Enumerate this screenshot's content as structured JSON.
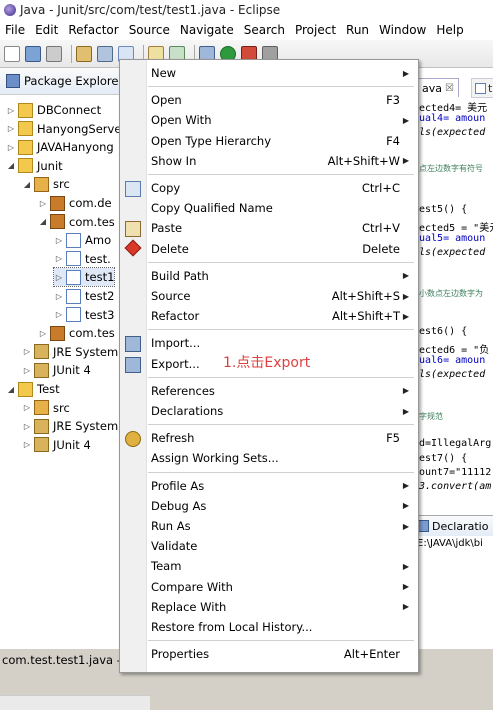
{
  "window": {
    "title": "Java - Junit/src/com/test/test1.java - Eclipse"
  },
  "menubar": [
    "File",
    "Edit",
    "Refactor",
    "Source",
    "Navigate",
    "Search",
    "Project",
    "Run",
    "Window",
    "Help"
  ],
  "package_explorer": {
    "title": "Package Explorer",
    "tree": [
      {
        "label": "DBConnect",
        "indent": 0,
        "arrow": "▷",
        "icon": "project-icon"
      },
      {
        "label": "HanyongServe",
        "indent": 0,
        "arrow": "▷",
        "icon": "project-icon"
      },
      {
        "label": "JAVAHanyong",
        "indent": 0,
        "arrow": "▷",
        "icon": "project-icon"
      },
      {
        "label": "Junit",
        "indent": 0,
        "arrow": "◢",
        "icon": "project-icon"
      },
      {
        "label": "src",
        "indent": 1,
        "arrow": "◢",
        "icon": "src-folder-icon"
      },
      {
        "label": "com.de",
        "indent": 2,
        "arrow": "▷",
        "icon": "package-icon"
      },
      {
        "label": "com.tes",
        "indent": 2,
        "arrow": "◢",
        "icon": "package-icon"
      },
      {
        "label": "Amo",
        "indent": 3,
        "arrow": "▷",
        "icon": "java-file-icon"
      },
      {
        "label": "test.",
        "indent": 3,
        "arrow": "▷",
        "icon": "java-file-icon"
      },
      {
        "label": "test1",
        "indent": 3,
        "arrow": "▷",
        "icon": "java-file-icon"
      },
      {
        "label": "test2",
        "indent": 3,
        "arrow": "▷",
        "icon": "java-file-icon"
      },
      {
        "label": "test3",
        "indent": 3,
        "arrow": "▷",
        "icon": "java-file-icon"
      },
      {
        "label": "com.tes",
        "indent": 2,
        "arrow": "▷",
        "icon": "package-icon"
      },
      {
        "label": "JRE System",
        "indent": 1,
        "arrow": "▷",
        "icon": "library-icon"
      },
      {
        "label": "JUnit 4",
        "indent": 1,
        "arrow": "▷",
        "icon": "library-icon"
      },
      {
        "label": "Test",
        "indent": 0,
        "arrow": "◢",
        "icon": "project-icon"
      },
      {
        "label": "src",
        "indent": 1,
        "arrow": "▷",
        "icon": "src-folder-icon"
      },
      {
        "label": "JRE System",
        "indent": 1,
        "arrow": "▷",
        "icon": "library-icon"
      },
      {
        "label": "JUnit 4",
        "indent": 1,
        "arrow": "▷",
        "icon": "library-icon"
      }
    ]
  },
  "editor": {
    "tab_label": "ava",
    "tab_close": "☒",
    "tab2_label": "te",
    "code_lines": [
      {
        "text": "ected4= 美元",
        "cls": ""
      },
      {
        "text": "ual4= amoun",
        "cls": "fld"
      },
      {
        "text": "ls(expected",
        "cls": "it"
      },
      {
        "text": "点左边数字有符号",
        "cls": "cm"
      },
      {
        "text": "est5() {",
        "cls": ""
      },
      {
        "text": "ected5 = \"美元",
        "cls": ""
      },
      {
        "text": "ual5= amoun",
        "cls": "fld"
      },
      {
        "text": "ls(expected",
        "cls": "it"
      },
      {
        "text": "小数点左边数字为",
        "cls": "cm"
      },
      {
        "text": "est6() {",
        "cls": ""
      },
      {
        "text": "ected6 = \"负",
        "cls": ""
      },
      {
        "text": "ual6= amoun",
        "cls": "fld"
      },
      {
        "text": "ls(expected",
        "cls": "it"
      },
      {
        "text": "字规范",
        "cls": "cm"
      },
      {
        "text": "d=IllegalArg",
        "cls": ""
      },
      {
        "text": "est7() {",
        "cls": ""
      },
      {
        "text": "ount7=\"11112",
        "cls": ""
      },
      {
        "text": "3.convert(am",
        "cls": "it"
      }
    ],
    "console_tab": "Declaratio",
    "console_path": "E:\\JAVA\\jdk\\bi"
  },
  "status": {
    "text": "com.test.test1.java - Ju"
  },
  "context_menu": {
    "items": [
      {
        "label": "New",
        "shortcut": "",
        "submenu": true,
        "icon": ""
      },
      {
        "sep": true
      },
      {
        "label": "Open",
        "shortcut": "F3",
        "submenu": false,
        "icon": ""
      },
      {
        "label": "Open With",
        "shortcut": "",
        "submenu": true,
        "icon": ""
      },
      {
        "label": "Open Type Hierarchy",
        "shortcut": "F4",
        "submenu": false,
        "icon": ""
      },
      {
        "label": "Show In",
        "shortcut": "Alt+Shift+W",
        "submenu": true,
        "icon": ""
      },
      {
        "sep": true
      },
      {
        "label": "Copy",
        "shortcut": "Ctrl+C",
        "submenu": false,
        "icon": "copy-icon"
      },
      {
        "label": "Copy Qualified Name",
        "shortcut": "",
        "submenu": false,
        "icon": ""
      },
      {
        "label": "Paste",
        "shortcut": "Ctrl+V",
        "submenu": false,
        "icon": "paste-icon"
      },
      {
        "label": "Delete",
        "shortcut": "Delete",
        "submenu": false,
        "icon": "delete-icon"
      },
      {
        "sep": true
      },
      {
        "label": "Build Path",
        "shortcut": "",
        "submenu": true,
        "icon": ""
      },
      {
        "label": "Source",
        "shortcut": "Alt+Shift+S",
        "submenu": true,
        "icon": ""
      },
      {
        "label": "Refactor",
        "shortcut": "Alt+Shift+T",
        "submenu": true,
        "icon": ""
      },
      {
        "sep": true
      },
      {
        "label": "Import...",
        "shortcut": "",
        "submenu": false,
        "icon": "import-icon"
      },
      {
        "label": "Export...",
        "shortcut": "",
        "submenu": false,
        "icon": "export-icon"
      },
      {
        "sep": true
      },
      {
        "label": "References",
        "shortcut": "",
        "submenu": true,
        "icon": ""
      },
      {
        "label": "Declarations",
        "shortcut": "",
        "submenu": true,
        "icon": ""
      },
      {
        "sep": true
      },
      {
        "label": "Refresh",
        "shortcut": "F5",
        "submenu": false,
        "icon": "refresh-icon"
      },
      {
        "label": "Assign Working Sets...",
        "shortcut": "",
        "submenu": false,
        "icon": ""
      },
      {
        "sep": true
      },
      {
        "label": "Profile As",
        "shortcut": "",
        "submenu": true,
        "icon": ""
      },
      {
        "label": "Debug As",
        "shortcut": "",
        "submenu": true,
        "icon": ""
      },
      {
        "label": "Run As",
        "shortcut": "",
        "submenu": true,
        "icon": ""
      },
      {
        "label": "Validate",
        "shortcut": "",
        "submenu": false,
        "icon": ""
      },
      {
        "label": "Team",
        "shortcut": "",
        "submenu": true,
        "icon": ""
      },
      {
        "label": "Compare With",
        "shortcut": "",
        "submenu": true,
        "icon": ""
      },
      {
        "label": "Replace With",
        "shortcut": "",
        "submenu": true,
        "icon": ""
      },
      {
        "label": "Restore from Local History...",
        "shortcut": "",
        "submenu": false,
        "icon": ""
      },
      {
        "sep": true
      },
      {
        "label": "Properties",
        "shortcut": "Alt+Enter",
        "submenu": false,
        "icon": ""
      }
    ]
  },
  "annotation": {
    "text": "1.点击Export",
    "color": "#e04040"
  }
}
